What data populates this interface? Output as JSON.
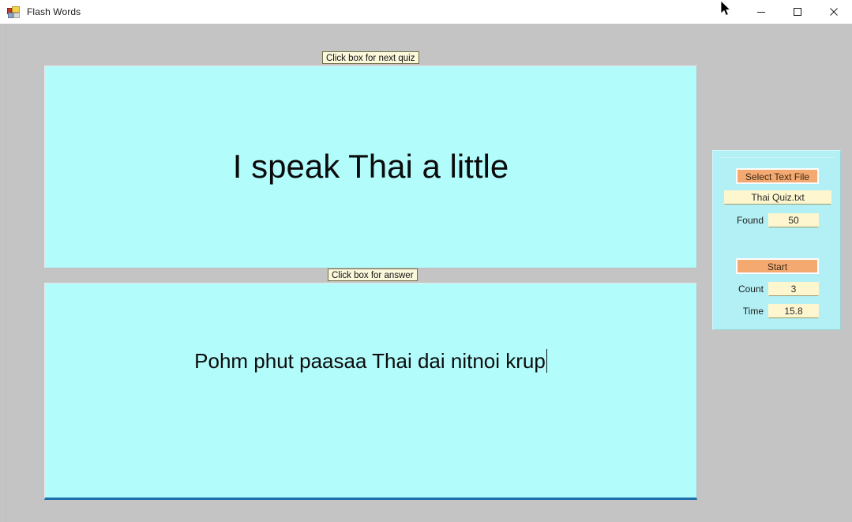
{
  "window": {
    "title": "Flash Words",
    "icon": "winforms-app-icon",
    "controls": [
      {
        "name": "minimize",
        "glyph": "minimize-icon"
      },
      {
        "name": "maximize",
        "glyph": "maximize-icon"
      },
      {
        "name": "close",
        "glyph": "close-icon"
      }
    ]
  },
  "colors": {
    "form_background": "#c4c4c4",
    "flash_box": "#b3fcfc",
    "panel_background": "#b3f0f5",
    "button_orange": "#f4a971",
    "field_cream": "#fdf6cf",
    "caption_cream": "#fbf8dc",
    "focus_border": "#1c6fa8"
  },
  "quiz": {
    "prompt_caption": "Click box for next quiz",
    "prompt_text": "I speak Thai a little",
    "answer_caption": "Click box for answer",
    "answer_text": "Pohm phut paasaa Thai dai nitnoi krup"
  },
  "panel": {
    "select_file_button": "Select Text File",
    "filename": "Thai Quiz.txt",
    "found_label": "Found",
    "found_value": "50",
    "start_button": "Start",
    "count_label": "Count",
    "count_value": "3",
    "time_label": "Time",
    "time_value": "15.8"
  }
}
